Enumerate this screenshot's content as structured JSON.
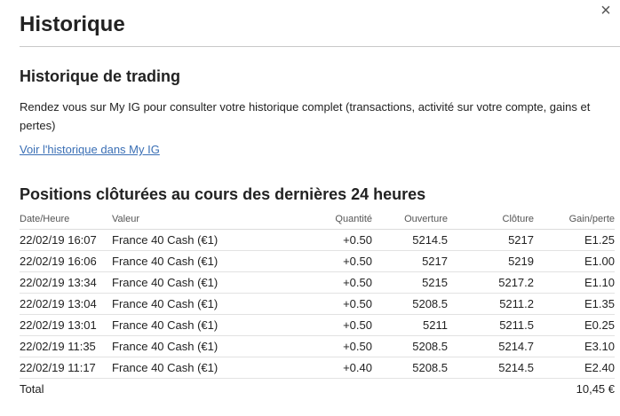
{
  "dialog": {
    "title": "Historique",
    "close_symbol": "×"
  },
  "trading_history": {
    "heading": "Historique de trading",
    "description": "Rendez vous sur My IG pour consulter votre historique complet (transactions, activité sur votre compte, gains et pertes)",
    "link_label": "Voir l'historique dans My IG"
  },
  "closed_positions": {
    "heading": "Positions clôturées au cours des dernières 24 heures",
    "columns": {
      "date": "Date/Heure",
      "asset": "Valeur",
      "quantity": "Quantité",
      "open": "Ouverture",
      "close": "Clôture",
      "pnl": "Gain/perte"
    },
    "rows": [
      {
        "date": "22/02/19 16:07",
        "asset": "France 40 Cash (€1)",
        "quantity": "+0.50",
        "open": "5214.5",
        "close": "5217",
        "pnl": "E1.25"
      },
      {
        "date": "22/02/19 16:06",
        "asset": "France 40 Cash (€1)",
        "quantity": "+0.50",
        "open": "5217",
        "close": "5219",
        "pnl": "E1.00"
      },
      {
        "date": "22/02/19 13:34",
        "asset": "France 40 Cash (€1)",
        "quantity": "+0.50",
        "open": "5215",
        "close": "5217.2",
        "pnl": "E1.10"
      },
      {
        "date": "22/02/19 13:04",
        "asset": "France 40 Cash (€1)",
        "quantity": "+0.50",
        "open": "5208.5",
        "close": "5211.2",
        "pnl": "E1.35"
      },
      {
        "date": "22/02/19 13:01",
        "asset": "France 40 Cash (€1)",
        "quantity": "+0.50",
        "open": "5211",
        "close": "5211.5",
        "pnl": "E0.25"
      },
      {
        "date": "22/02/19 11:35",
        "asset": "France 40 Cash (€1)",
        "quantity": "+0.50",
        "open": "5208.5",
        "close": "5214.7",
        "pnl": "E3.10"
      },
      {
        "date": "22/02/19 11:17",
        "asset": "France 40 Cash (€1)",
        "quantity": "+0.40",
        "open": "5208.5",
        "close": "5214.5",
        "pnl": "E2.40"
      }
    ],
    "total_label": "Total",
    "total_value": "10,45 €"
  },
  "colors": {
    "accent": "#3a6fb5",
    "text": "#222222",
    "rule": "#c9c9c9"
  }
}
